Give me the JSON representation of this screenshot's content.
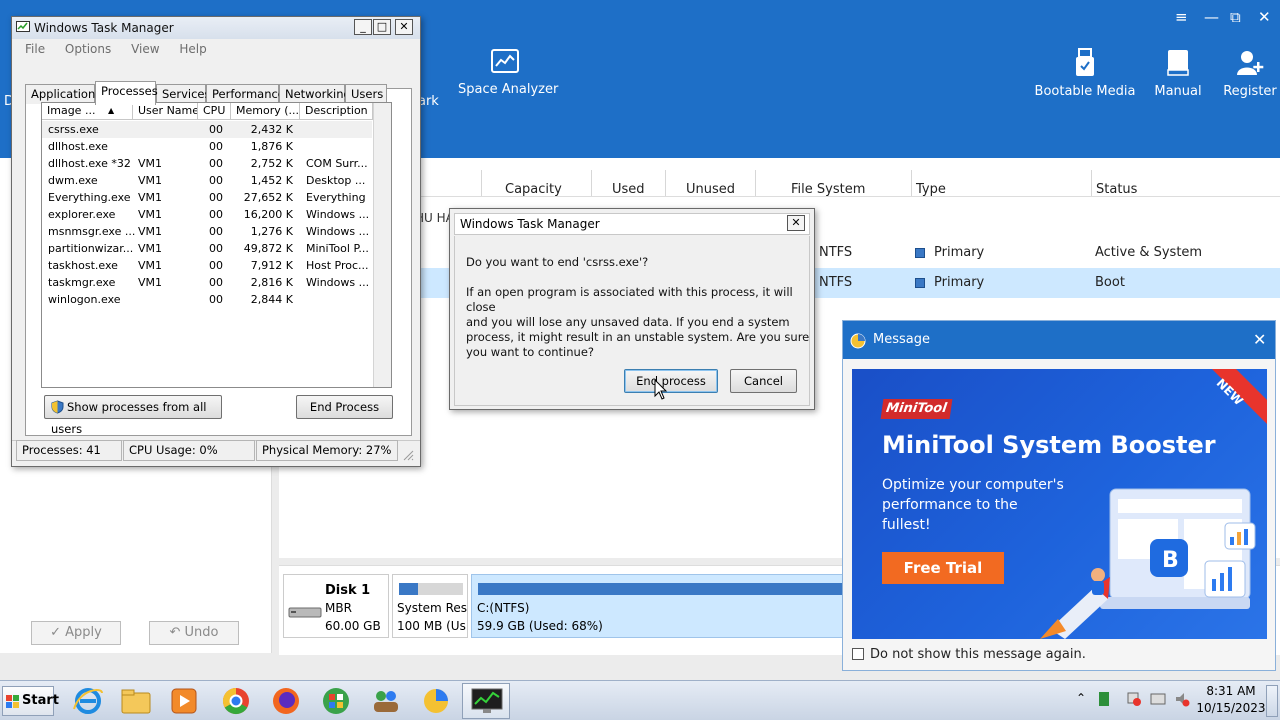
{
  "minitool": {
    "toolbar": {
      "partial_label": "ark",
      "space_analyzer": "Space Analyzer",
      "bootable_media": "Bootable Media",
      "manual": "Manual",
      "register": "Register",
      "left_partial": "D"
    },
    "window_controls": [
      "≡",
      "—",
      "⧉",
      "✕"
    ],
    "columns": [
      "Capacity",
      "Used",
      "Unused",
      "File System",
      "Type",
      "Status"
    ],
    "disk_header_partial": "HU HA",
    "rows": [
      {
        "fs": "NTFS",
        "type": "Primary",
        "status": "Active & System"
      },
      {
        "fs": "NTFS",
        "type": "Primary",
        "status": "Boot"
      }
    ],
    "apply_label": "✓ Apply",
    "undo_label": "↶ Undo",
    "disk": {
      "name": "Disk 1",
      "scheme": "MBR",
      "size": "60.00 GB",
      "part1_name": "System Rese",
      "part1_size": "100 MB (Us",
      "part2_name": "C:(NTFS)",
      "part2_size": "59.9 GB (Used: 68%)",
      "part1_used_fraction": 0.3,
      "part2_used_fraction": 0.68
    }
  },
  "task_manager": {
    "title": "Windows Task Manager",
    "menu": [
      "File",
      "Options",
      "View",
      "Help"
    ],
    "tabs": [
      "Applications",
      "Processes",
      "Services",
      "Performance",
      "Networking",
      "Users"
    ],
    "active_tab": "Processes",
    "columns": [
      "Image ...",
      "User Name",
      "CPU",
      "Memory (...",
      "Description"
    ],
    "processes": [
      {
        "image": "csrss.exe",
        "user": "",
        "cpu": "00",
        "mem": "2,432 K",
        "desc": ""
      },
      {
        "image": "dllhost.exe",
        "user": "",
        "cpu": "00",
        "mem": "1,876 K",
        "desc": ""
      },
      {
        "image": "dllhost.exe *32",
        "user": "VM1",
        "cpu": "00",
        "mem": "2,752 K",
        "desc": "COM Surr..."
      },
      {
        "image": "dwm.exe",
        "user": "VM1",
        "cpu": "00",
        "mem": "1,452 K",
        "desc": "Desktop ..."
      },
      {
        "image": "Everything.exe",
        "user": "VM1",
        "cpu": "00",
        "mem": "27,652 K",
        "desc": "Everything"
      },
      {
        "image": "explorer.exe",
        "user": "VM1",
        "cpu": "00",
        "mem": "16,200 K",
        "desc": "Windows ..."
      },
      {
        "image": "msnmsgr.exe ...",
        "user": "VM1",
        "cpu": "00",
        "mem": "1,276 K",
        "desc": "Windows ..."
      },
      {
        "image": "partitionwizar...",
        "user": "VM1",
        "cpu": "00",
        "mem": "49,872 K",
        "desc": "MiniTool P..."
      },
      {
        "image": "taskhost.exe",
        "user": "VM1",
        "cpu": "00",
        "mem": "7,912 K",
        "desc": "Host Proc..."
      },
      {
        "image": "taskmgr.exe",
        "user": "VM1",
        "cpu": "00",
        "mem": "2,816 K",
        "desc": "Windows ..."
      },
      {
        "image": "winlogon.exe",
        "user": "",
        "cpu": "00",
        "mem": "2,844 K",
        "desc": ""
      }
    ],
    "show_all_label": "Show processes from all users",
    "end_process_label": "End Process",
    "status": {
      "processes": "Processes: 41",
      "cpu": "CPU Usage: 0%",
      "memory": "Physical Memory: 27%"
    }
  },
  "dialog": {
    "title": "Windows Task Manager",
    "question": "Do you want to end 'csrss.exe'?",
    "warning_lines": [
      "If an open program is associated with this process, it will close",
      "and you will lose any unsaved data. If you end a system",
      "process, it might result in an unstable system. Are you sure",
      "you want to continue?"
    ],
    "confirm_label": "End process",
    "cancel_label": "Cancel"
  },
  "message": {
    "title": "Message",
    "ad": {
      "ribbon": "NEW",
      "brand": "MiniTool",
      "headline": "MiniTool System Booster",
      "body_lines": [
        "Optimize your computer's",
        "performance to the",
        "fullest!"
      ],
      "cta": "Free Trial"
    },
    "dont_show_label": "Do not show this message again."
  },
  "taskbar": {
    "start_label": "Start",
    "time": "8:31 AM",
    "date": "10/15/2023"
  },
  "colors": {
    "minitool_blue": "#1e6fc7",
    "ad_orange": "#f26a21",
    "selection": "#cde8ff"
  }
}
